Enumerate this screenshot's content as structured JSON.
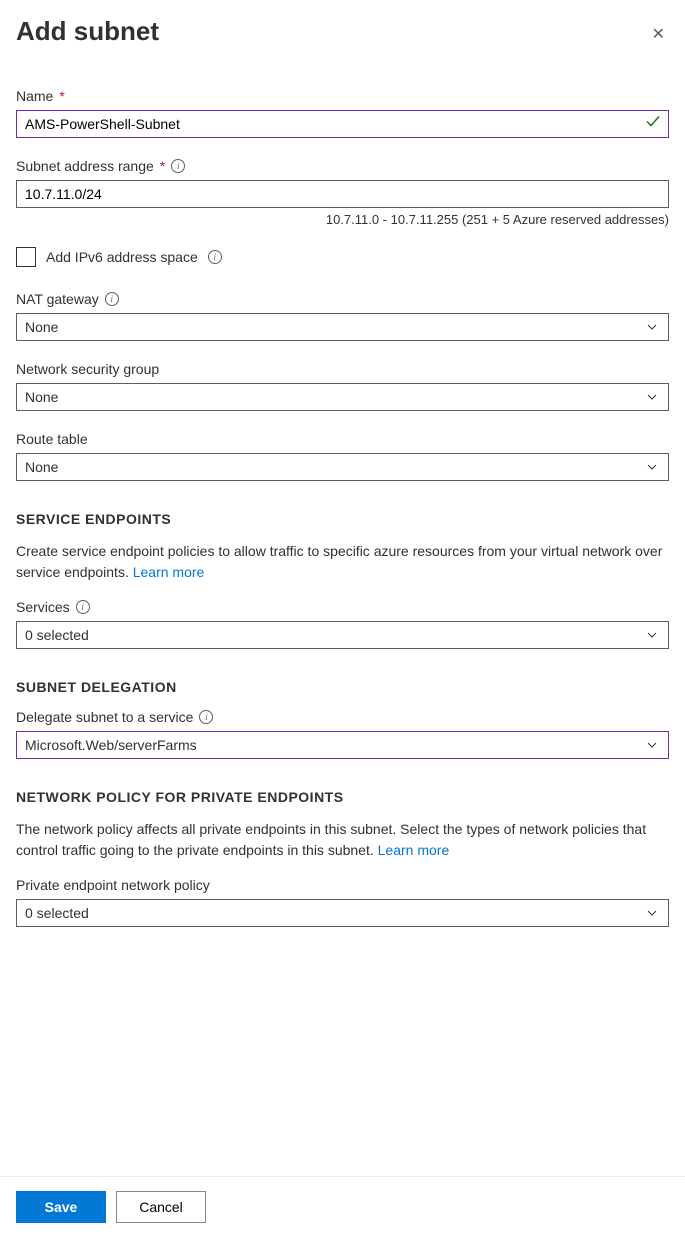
{
  "header": {
    "title": "Add subnet"
  },
  "fields": {
    "name": {
      "label": "Name",
      "value": "AMS-PowerShell-Subnet",
      "required": true
    },
    "subnet_range": {
      "label": "Subnet address range",
      "value": "10.7.11.0/24",
      "required": true,
      "helper": "10.7.11.0 - 10.7.11.255 (251 + 5 Azure reserved addresses)"
    },
    "ipv6": {
      "label": "Add IPv6 address space"
    },
    "nat_gateway": {
      "label": "NAT gateway",
      "value": "None"
    },
    "nsg": {
      "label": "Network security group",
      "value": "None"
    },
    "route_table": {
      "label": "Route table",
      "value": "None"
    }
  },
  "service_endpoints": {
    "header": "SERVICE ENDPOINTS",
    "desc": "Create service endpoint policies to allow traffic to specific azure resources from your virtual network over service endpoints. ",
    "learn_more": "Learn more",
    "services": {
      "label": "Services",
      "value": "0 selected"
    }
  },
  "subnet_delegation": {
    "header": "SUBNET DELEGATION",
    "delegate": {
      "label": "Delegate subnet to a service",
      "value": "Microsoft.Web/serverFarms"
    }
  },
  "network_policy": {
    "header": "NETWORK POLICY FOR PRIVATE ENDPOINTS",
    "desc": "The network policy affects all private endpoints in this subnet. Select the types of network policies that control traffic going to the private endpoints in this subnet. ",
    "learn_more": "Learn more",
    "policy": {
      "label": "Private endpoint network policy",
      "value": "0 selected"
    }
  },
  "footer": {
    "save": "Save",
    "cancel": "Cancel"
  }
}
